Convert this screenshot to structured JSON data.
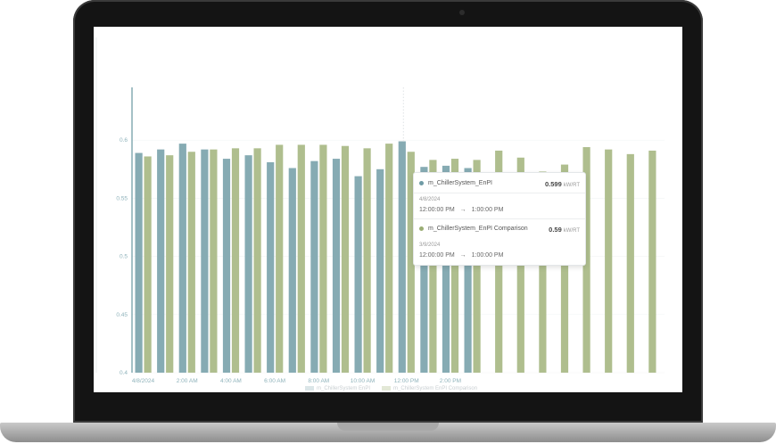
{
  "colors": {
    "series_actual": "#86abb3",
    "series_comparison": "#afbe8e",
    "axis": "#86abb3",
    "tick_text": "#8fb3bb"
  },
  "chart_data": {
    "type": "bar",
    "y_ticks": [
      "0.4",
      "0.45",
      "0.5",
      "0.55",
      "0.6"
    ],
    "ylim": [
      0.4,
      0.65
    ],
    "x_tick_labels": [
      "4/8/2024",
      "2:00 AM",
      "4:00 AM",
      "6:00 AM",
      "8:00 AM",
      "10:00 AM",
      "12:00 PM",
      "2:00 PM"
    ],
    "x_tick_hours": [
      0,
      2,
      4,
      6,
      8,
      10,
      12,
      14
    ],
    "hours": [
      0,
      1,
      2,
      3,
      4,
      5,
      6,
      7,
      8,
      9,
      10,
      11,
      12,
      13,
      14,
      15,
      16,
      17,
      18,
      19,
      20,
      21,
      22,
      23
    ],
    "series": [
      {
        "name": "m_ChillerSystem_EnPI",
        "values": [
          0.589,
          0.592,
          0.597,
          0.592,
          0.584,
          0.587,
          0.581,
          0.576,
          0.582,
          0.584,
          0.569,
          0.575,
          0.599,
          0.577,
          0.578,
          0.576,
          null,
          null,
          null,
          null,
          null,
          null,
          null,
          null
        ]
      },
      {
        "name": "m_ChillerSystem_EnPI Comparison",
        "values": [
          0.586,
          0.587,
          0.59,
          0.592,
          0.593,
          0.593,
          0.596,
          0.596,
          0.596,
          0.595,
          0.593,
          0.597,
          0.59,
          0.583,
          0.584,
          0.583,
          0.591,
          0.585,
          0.573,
          0.579,
          0.594,
          0.592,
          0.588,
          0.591
        ]
      }
    ],
    "legend": {
      "placement": "bottom",
      "items": [
        "m_ChillerSystem EnPI",
        "m_ChillerSystem EnPI Comparison"
      ]
    }
  },
  "tooltip": {
    "series1_name": "m_ChillerSystem_EnPI",
    "series1_value": "0.599",
    "series1_unit": "kW/RT",
    "series1_date": "4/8/2024",
    "series1_start": "12:00:00 PM",
    "series1_end": "1:00:00 PM",
    "series2_name": "m_ChillerSystem_EnPI Comparison",
    "series2_value": "0.59",
    "series2_unit": "kW/RT",
    "series2_date": "3/9/2024",
    "series2_start": "12:00:00 PM",
    "series2_end": "1:00:00 PM",
    "arrow": "→"
  }
}
